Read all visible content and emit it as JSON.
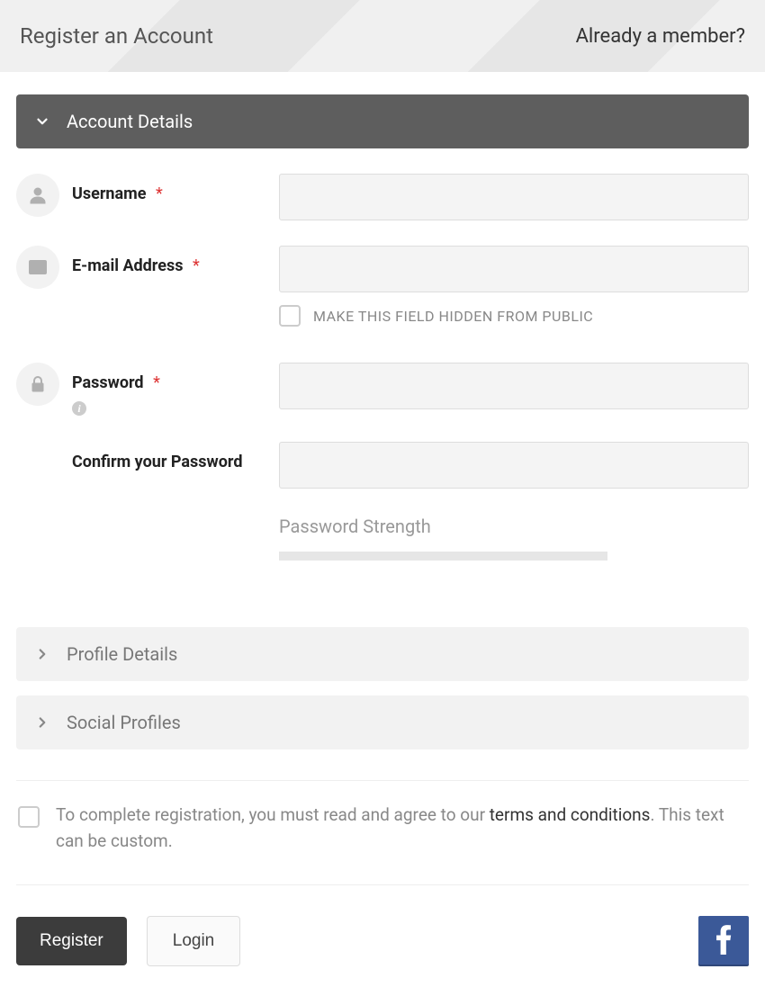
{
  "header": {
    "title": "Register an Account",
    "member_link": "Already a member?"
  },
  "sections": {
    "account": {
      "title": "Account Details",
      "fields": {
        "username": {
          "label": "Username",
          "required": "*",
          "value": ""
        },
        "email": {
          "label": "E-mail Address",
          "required": "*",
          "value": "",
          "hide_label": "MAKE THIS FIELD HIDDEN FROM PUBLIC"
        },
        "password": {
          "label": "Password",
          "required": "*",
          "value": ""
        },
        "confirm": {
          "label": "Confirm your Password",
          "value": ""
        },
        "strength_label": "Password Strength"
      }
    },
    "profile": {
      "title": "Profile Details"
    },
    "social": {
      "title": "Social Profiles"
    }
  },
  "terms": {
    "text_before": "To complete registration, you must read and agree to our ",
    "link": "terms and conditions",
    "text_after": ". This text can be custom."
  },
  "buttons": {
    "register": "Register",
    "login": "Login"
  }
}
